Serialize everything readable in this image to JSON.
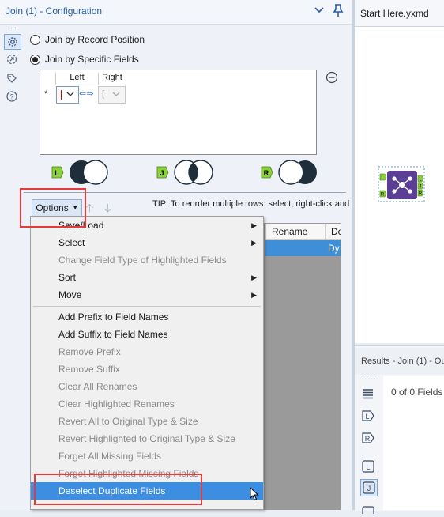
{
  "config_panel": {
    "title": "Join (1) - Configuration",
    "side_icons": [
      "gear-icon",
      "connection-icon",
      "tag-icon",
      "help-icon"
    ],
    "join_mode_options": [
      {
        "label": "Join by Record Position",
        "selected": false
      },
      {
        "label": "Join by Specific Fields",
        "selected": true
      }
    ],
    "field_grid": {
      "headers": [
        "Left",
        "Right"
      ],
      "row_marker": "*",
      "right_value": "["
    },
    "outputs": [
      "L",
      "J",
      "R"
    ],
    "options_button": "Options",
    "tip": "TIP: To reorder multiple rows: select, right-click and",
    "table_headers": [
      "Rename",
      "De"
    ],
    "selected_row_value": "Dy"
  },
  "options_menu": {
    "items": [
      {
        "label": "Save/Load",
        "enabled": true,
        "submenu": true
      },
      {
        "label": "Select",
        "enabled": true,
        "submenu": true
      },
      {
        "label": "Change Field Type of Highlighted Fields",
        "enabled": false,
        "submenu": false
      },
      {
        "label": "Sort",
        "enabled": true,
        "submenu": true
      },
      {
        "label": "Move",
        "enabled": true,
        "submenu": true
      },
      {
        "separator": true
      },
      {
        "label": "Add Prefix to Field Names",
        "enabled": true,
        "submenu": false
      },
      {
        "label": "Add Suffix to Field Names",
        "enabled": true,
        "submenu": false
      },
      {
        "label": "Remove Prefix",
        "enabled": false,
        "submenu": false
      },
      {
        "label": "Remove Suffix",
        "enabled": false,
        "submenu": false
      },
      {
        "label": "Clear All Renames",
        "enabled": false,
        "submenu": false
      },
      {
        "label": "Clear Highlighted Renames",
        "enabled": false,
        "submenu": false
      },
      {
        "label": "Revert All to Original Type & Size",
        "enabled": false,
        "submenu": false
      },
      {
        "label": "Revert Highlighted to Original Type & Size",
        "enabled": false,
        "submenu": false
      },
      {
        "label": "Forget All Missing Fields",
        "enabled": false,
        "submenu": false
      },
      {
        "label": "Forget Highlighted Missing Fields",
        "enabled": false,
        "submenu": false
      },
      {
        "label": "Deselect Duplicate Fields",
        "enabled": true,
        "submenu": false,
        "highlighted": true
      }
    ]
  },
  "workflow": {
    "tab_title": "Start Here.yxmd",
    "tool_inputs": [
      "L",
      "R"
    ],
    "tool_outputs": [
      "L",
      "J",
      "R"
    ]
  },
  "results": {
    "title": "Results - Join (1) - Ou",
    "fields_count": "0 of 0 Fields",
    "side_icons": [
      "table-icon",
      "left-input-icon",
      "right-input-icon",
      "left-output-icon",
      "join-output-icon"
    ]
  },
  "colors": {
    "accent": "#2a5da8",
    "highlight": "#3d8ee0",
    "annotation_red": "#e43b3b",
    "output_green": "#8cd13a",
    "tool_purple": "#5b3e96",
    "venn_dark": "#1e2f3b"
  }
}
